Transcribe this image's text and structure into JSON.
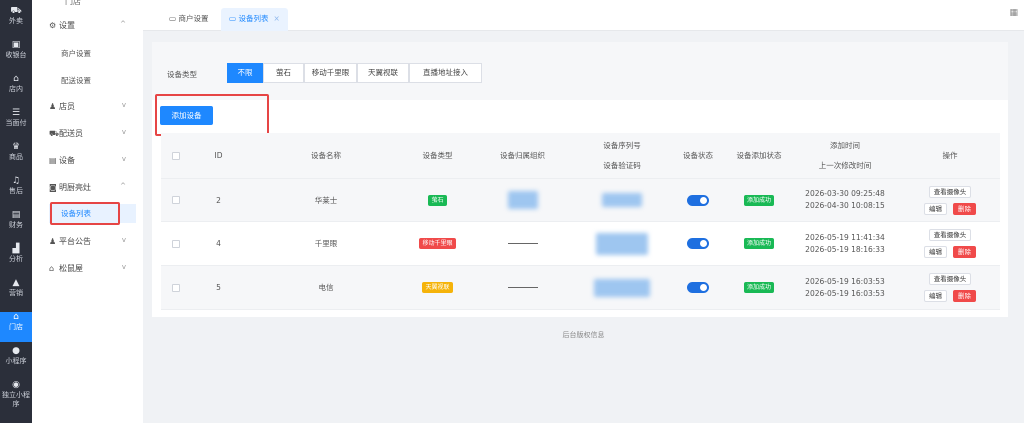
{
  "rail": [
    {
      "icon": "⛟",
      "label": "外卖",
      "icon_name": "delivery-icon"
    },
    {
      "icon": "▣",
      "label": "收银台",
      "icon_name": "cashier-icon"
    },
    {
      "icon": "⌂",
      "label": "店内",
      "icon_name": "store-icon"
    },
    {
      "icon": "☰",
      "label": "当面付",
      "icon_name": "pay-icon"
    },
    {
      "icon": "♛",
      "label": "商品",
      "icon_name": "goods-icon"
    },
    {
      "icon": "♫",
      "label": "售后",
      "icon_name": "after-sale-icon"
    },
    {
      "icon": "▤",
      "label": "财务",
      "icon_name": "finance-icon"
    },
    {
      "icon": "▟",
      "label": "分析",
      "icon_name": "analysis-icon"
    },
    {
      "icon": "▲",
      "label": "营销",
      "icon_name": "marketing-icon"
    },
    {
      "icon": "⌂",
      "label": "门店",
      "icon_name": "shop-icon"
    },
    {
      "icon": "●",
      "label": "小程序",
      "icon_name": "miniapp-icon"
    },
    {
      "icon": "◉",
      "label": "独立小程序",
      "icon_name": "standalone-miniapp-icon"
    }
  ],
  "sidebar": {
    "top_label": "门店",
    "groups": [
      {
        "label": "设置",
        "chev": "^"
      },
      {
        "label": "店员",
        "chev": "v"
      },
      {
        "label": "配送员",
        "chev": "v"
      },
      {
        "label": "设备",
        "chev": "v"
      },
      {
        "label": "明厨亮灶",
        "chev": "^"
      },
      {
        "label": "平台公告",
        "chev": "v"
      },
      {
        "label": "松鼠屋",
        "chev": "v"
      }
    ],
    "settings_subs": [
      "商户设置",
      "配送设置"
    ],
    "kitchen_subs": [
      "设备列表"
    ]
  },
  "tabs": [
    {
      "label": "商户设置"
    },
    {
      "label": "设备列表",
      "close": "×"
    }
  ],
  "filter": {
    "label": "设备类型",
    "options": [
      "不限",
      "萤石",
      "移动千里眼",
      "天翼视联",
      "直播地址接入"
    ],
    "selected": "不限"
  },
  "add_button": "添加设备",
  "table": {
    "headers": {
      "id": "ID",
      "name": "设备名称",
      "type": "设备类型",
      "org": "设备归属组织",
      "serial": "设备序列号",
      "code": "设备验证码",
      "status": "设备状态",
      "add_status": "设备添加状态",
      "add_time": "添加时间",
      "mod_time": "上一次修改时间",
      "ops": "操作"
    },
    "rows": [
      {
        "id": "2",
        "name": "华莱士",
        "type": "萤石",
        "type_color": "#19b955",
        "org": "blurred",
        "status": "on",
        "add_status": "添加成功",
        "add_time": "2026-03-30 09:25:48",
        "mod_time": "2026-04-30 10:08:15"
      },
      {
        "id": "4",
        "name": "千里眼",
        "type": "移动千里眼",
        "type_color": "#f04a4a",
        "org": "————",
        "status": "on",
        "add_status": "添加成功",
        "add_time": "2026-05-19 11:41:34",
        "mod_time": "2026-05-19 18:16:33"
      },
      {
        "id": "5",
        "name": "电信",
        "type": "天翼视联",
        "type_color": "#f5b30a",
        "org": "————",
        "status": "on",
        "add_status": "添加成功",
        "add_time": "2026-05-19 16:03:53",
        "mod_time": "2026-05-19 16:03:53"
      }
    ],
    "op_view": "查看摄像头",
    "op_edit": "编辑",
    "op_delete": "删除"
  },
  "footer": "后台版权信息",
  "colors": {
    "accent": "#1e88ff",
    "success": "#19b955",
    "danger": "#f04a4a",
    "warning": "#f5b30a"
  }
}
